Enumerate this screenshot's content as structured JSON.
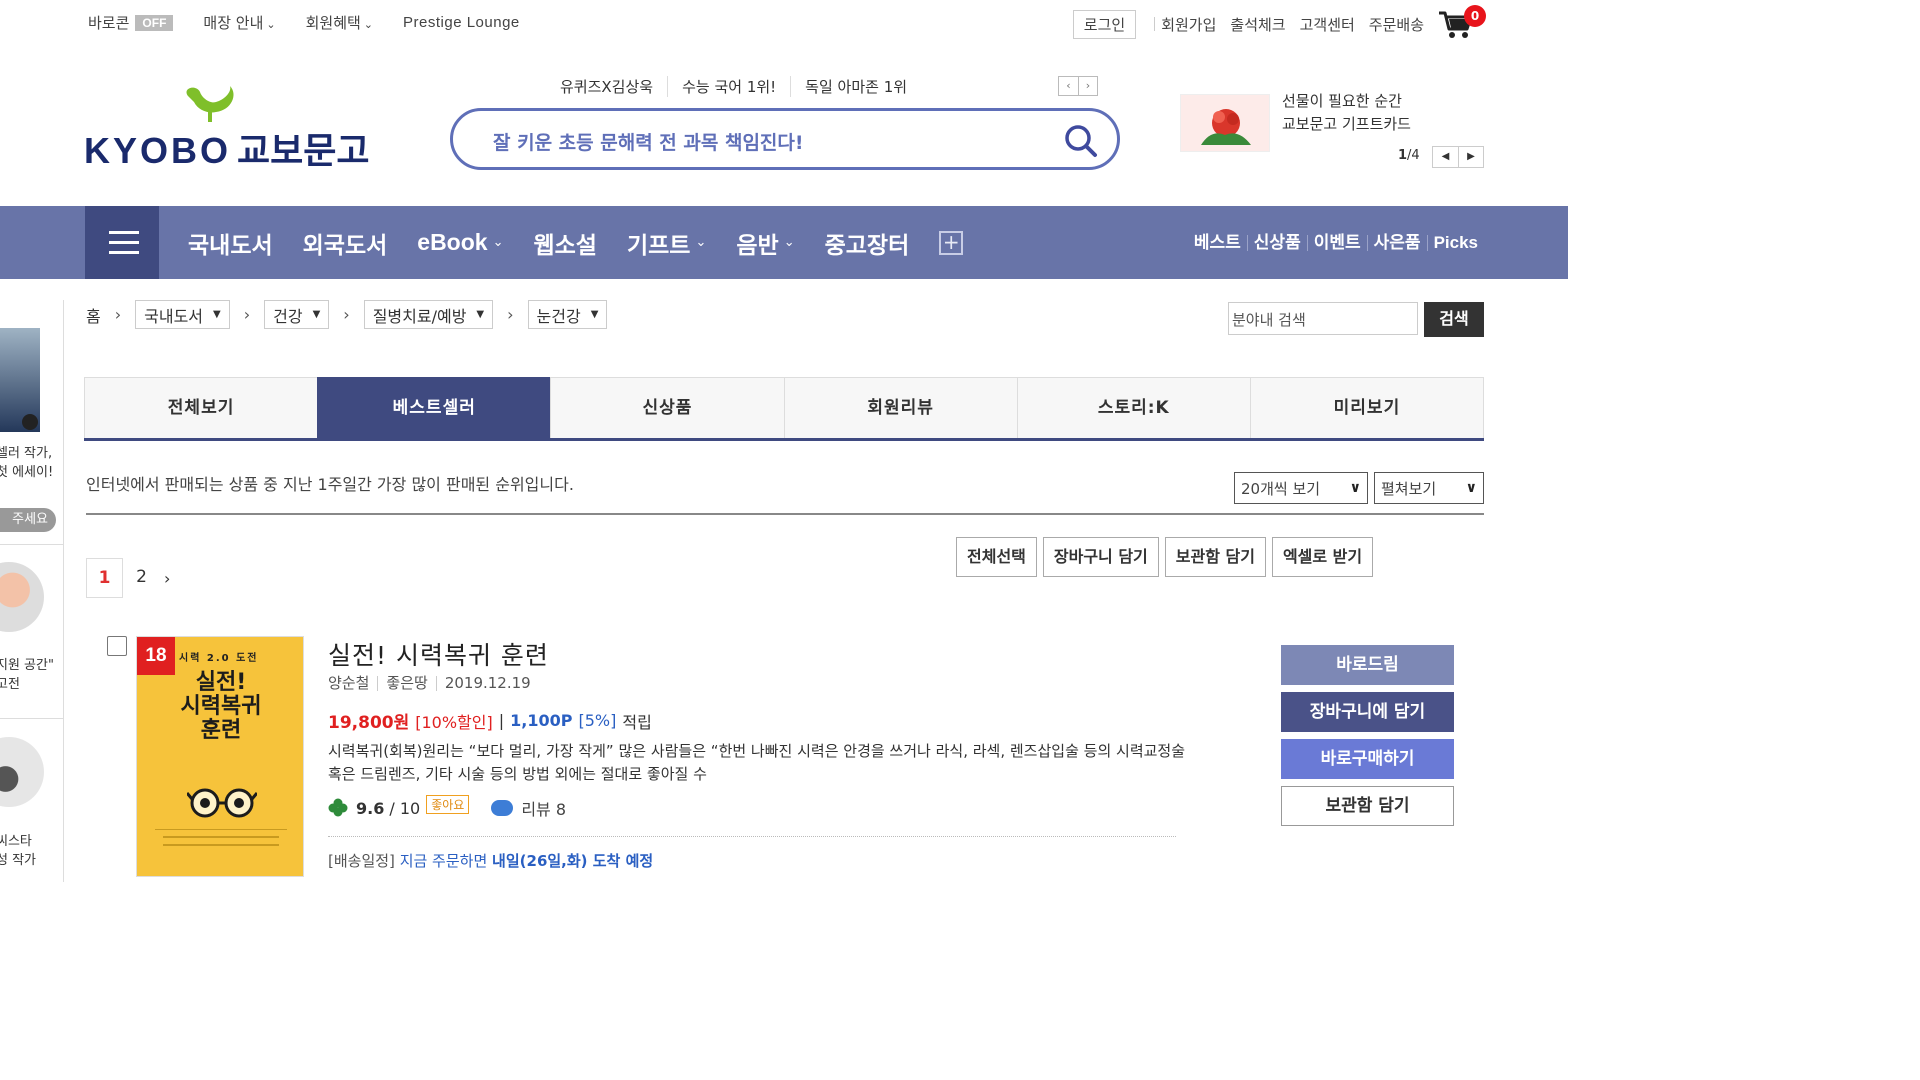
{
  "util_bar": {
    "baro": "바로콘",
    "baro_badge": "OFF",
    "store_info": "매장 안내",
    "member_benefit": "회원혜택",
    "prestige": "Prestige Lounge",
    "login": "로그인",
    "links": [
      "회원가입",
      "출석체크",
      "고객센터",
      "주문배송"
    ],
    "cart_count": "0"
  },
  "header": {
    "logo_en": "KYOBO",
    "logo_ko": "교보문고",
    "keywords": [
      "유퀴즈X김상욱",
      "수능 국어 1위!",
      "독일 아마존 1위"
    ],
    "search_placeholder": "잘 키운 초등 문해력 전 과목 책임진다!",
    "promo_lines": [
      "선물이 필요한 순간",
      "교보문고 기프트카드"
    ],
    "promo_page_current": "1",
    "promo_page_total": "/4"
  },
  "gnb": {
    "categories": [
      {
        "label": "국내도서",
        "dropdown": false
      },
      {
        "label": "외국도서",
        "dropdown": false
      },
      {
        "label": "eBook",
        "dropdown": true
      },
      {
        "label": "웹소설",
        "dropdown": false
      },
      {
        "label": "기프트",
        "dropdown": true
      },
      {
        "label": "음반",
        "dropdown": true
      },
      {
        "label": "중고장터",
        "dropdown": false
      }
    ],
    "sub_links": [
      "베스트",
      "신상품",
      "이벤트",
      "사은품",
      "Picks"
    ]
  },
  "left_strip": {
    "text1": [
      "셀러 작가,",
      "첫 에세이!"
    ],
    "button": "주세요",
    "text2": [
      "지원 공간\"",
      "고전"
    ],
    "text3": [
      "씨스타",
      "성 작가"
    ]
  },
  "breadcrumb": {
    "home": "홈",
    "items": [
      "국내도서",
      "건강",
      "질병치료/예방",
      "눈건강"
    ],
    "search_placeholder": "분야내 검색",
    "search_button": "검색"
  },
  "tabs": [
    {
      "label": "전체보기",
      "active": false
    },
    {
      "label": "베스트셀러",
      "active": true
    },
    {
      "label": "신상품",
      "active": false
    },
    {
      "label": "회원리뷰",
      "active": false
    },
    {
      "label": "스토리:K",
      "active": false
    },
    {
      "label": "미리보기",
      "active": false
    }
  ],
  "list_info": {
    "description": "인터넷에서 판매되는 상품 중 지난 1주일간 가장 많이 판매된 순위입니다.",
    "per_page": "20개씩 보기",
    "view_mode": "펼쳐보기",
    "actions": [
      "전체선택",
      "장바구니 담기",
      "보관함 담기",
      "엑셀로 받기"
    ],
    "pages": [
      "1",
      "2"
    ],
    "current_page": "1"
  },
  "product": {
    "rank": "18",
    "cover_top": "시력 2.0 도전",
    "cover_title": [
      "실전!",
      "시력복귀",
      "훈련"
    ],
    "title": "실전! 시력복귀 훈련",
    "meta": [
      "양순철",
      "좋은땅",
      "2019.12.19"
    ],
    "price": "19,800원",
    "discount": "[10%할인]",
    "points": "1,100P",
    "point_rate": "[5%]",
    "accrue": "적립",
    "summary": "시력복귀(회복)원리는 “보다 멀리, 가장 작게” 많은 사람들은 “한번 나빠진 시력은 안경을 쓰거나 라식, 라섹, 렌즈삽입술 등의 시력교정술 혹은 드림렌즈, 기타 시술 등의 방법 외에는 절대로 좋아질 수",
    "rating": "9.6",
    "rating_max": "/ 10",
    "rating_badge": "좋아요",
    "review": "리뷰 8",
    "delivery_prefix": "[배송일정]",
    "delivery_mid": "지금 주문하면",
    "delivery_bold": "내일(26일,화) 도착 예정",
    "buttons": [
      "바로드림",
      "장바구니에 담기",
      "바로구매하기",
      "보관함 담기"
    ]
  },
  "colors": {
    "gnb": "#6874a8",
    "gnb_dark": "#3f4a80",
    "accent_red": "#e02020",
    "accent_blue": "#2a5fc2",
    "search_border": "#5f6fb8"
  }
}
